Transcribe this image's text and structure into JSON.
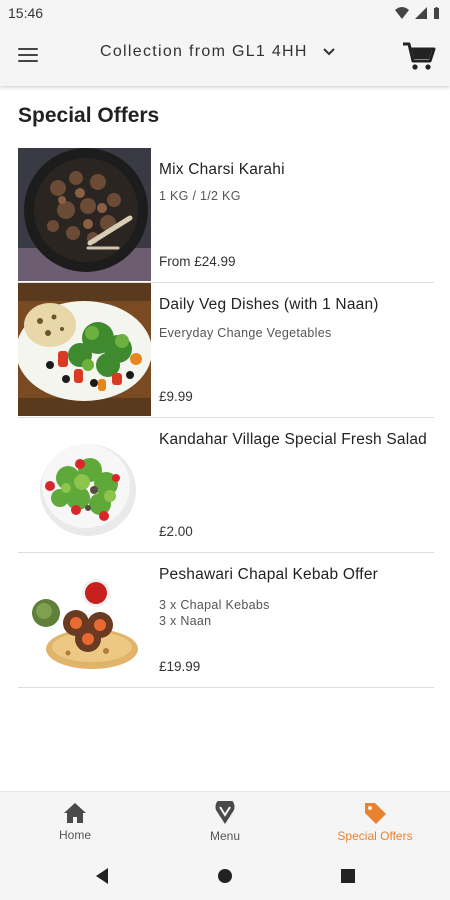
{
  "status_bar": {
    "time": "15:46"
  },
  "header": {
    "location_label": "Collection from GL1 4HH"
  },
  "page": {
    "title": "Special Offers"
  },
  "offers": [
    {
      "name": "Mix Charsi Karahi",
      "description": "1 KG / 1/2 KG",
      "price": "From £24.99"
    },
    {
      "name": "Daily Veg Dishes (with 1 Naan)",
      "description": "Everyday Change Vegetables",
      "price": "£9.99"
    },
    {
      "name": "Kandahar Village Special Fresh Salad",
      "description": "",
      "price": "£2.00"
    },
    {
      "name": "Peshawari Chapal Kebab Offer",
      "description_lines": [
        "3 x Chapal Kebabs",
        "3 x Naan"
      ],
      "price": "£19.99"
    }
  ],
  "bottom_nav": [
    {
      "label": "Home",
      "icon": "home-icon"
    },
    {
      "label": "Menu",
      "icon": "menu-pin-icon"
    },
    {
      "label": "Special Offers",
      "icon": "tag-icon",
      "active": true
    }
  ],
  "colors": {
    "accent": "#e9822f",
    "bar_bg": "#f5f5f5",
    "divider": "#dddddd"
  }
}
